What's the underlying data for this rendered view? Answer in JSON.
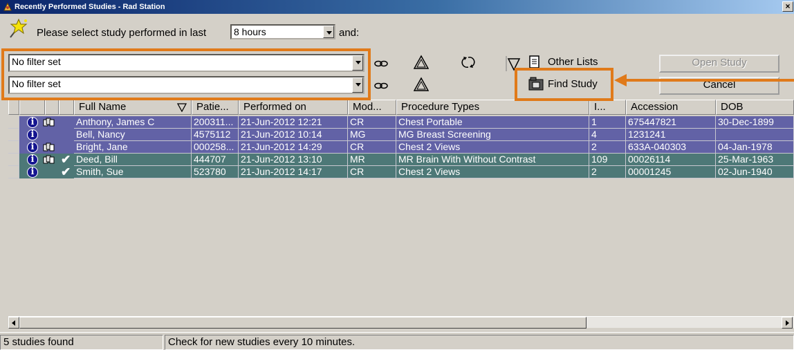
{
  "window": {
    "title": "Recently Performed Studies - Rad Station",
    "close_label": "×"
  },
  "header": {
    "prompt": "Please select study performed in last",
    "hours_value": "8 hours",
    "and_label": "and:"
  },
  "filters": [
    {
      "value": "No filter set"
    },
    {
      "value": "No filter set"
    }
  ],
  "toolbar": {
    "other_lists_label": "Other Lists",
    "find_study_label": "Find Study",
    "open_study_label": "Open Study",
    "cancel_label": "Cancel"
  },
  "columns": [
    {
      "label": ""
    },
    {
      "label": ""
    },
    {
      "label": ""
    },
    {
      "label": "Full Name"
    },
    {
      "label": "Patie..."
    },
    {
      "label": "Performed on"
    },
    {
      "label": "Mod..."
    },
    {
      "label": "Procedure Types"
    },
    {
      "label": "I..."
    },
    {
      "label": "Accession"
    },
    {
      "label": "DOB"
    }
  ],
  "rows": [
    {
      "name": "Anthony, James C",
      "patient_id": "200311...",
      "performed_on": "21-Jun-2012 12:21",
      "modality": "CR",
      "procedure": "Chest Portable",
      "images": "1",
      "accession": "675447821",
      "dob": "30-Dec-1899",
      "info": true,
      "images_icon": true,
      "checked": false,
      "style": "blue"
    },
    {
      "name": "Bell, Nancy",
      "patient_id": "4575112",
      "performed_on": "21-Jun-2012 10:14",
      "modality": "MG",
      "procedure": "MG Breast Screening",
      "images": "4",
      "accession": "1231241",
      "dob": "",
      "info": true,
      "images_icon": false,
      "checked": false,
      "style": "blue"
    },
    {
      "name": "Bright, Jane",
      "patient_id": "000258...",
      "performed_on": "21-Jun-2012 14:29",
      "modality": "CR",
      "procedure": "Chest 2 Views",
      "images": "2",
      "accession": "633A-040303",
      "dob": "04-Jan-1978",
      "info": true,
      "images_icon": true,
      "checked": false,
      "style": "blue"
    },
    {
      "name": "Deed, Bill",
      "patient_id": "444707",
      "performed_on": "21-Jun-2012 13:10",
      "modality": "MR",
      "procedure": "MR Brain With Without Contrast",
      "images": "109",
      "accession": "00026114",
      "dob": "25-Mar-1963",
      "info": true,
      "images_icon": true,
      "checked": true,
      "style": "teal"
    },
    {
      "name": "Smith, Sue",
      "patient_id": "523780",
      "performed_on": "21-Jun-2012 14:17",
      "modality": "CR",
      "procedure": "Chest 2 Views",
      "images": "2",
      "accession": "00001245",
      "dob": "02-Jun-1940",
      "info": true,
      "images_icon": false,
      "checked": true,
      "style": "teal"
    }
  ],
  "status": {
    "count_text": "5 studies found",
    "refresh_text": "Check for new studies every 10 minutes."
  },
  "colors": {
    "accent_highlight": "#e07a1a",
    "row_unread": "#6262a6",
    "row_read": "#4d7877"
  },
  "icons": {
    "link": "link-icon",
    "warning": "warning-icon",
    "refresh": "refresh-icon",
    "filter": "funnel-icon",
    "list": "document-list-icon",
    "find": "folder-search-icon",
    "info": "info-icon",
    "images": "image-stack-icon",
    "check": "check-icon"
  }
}
